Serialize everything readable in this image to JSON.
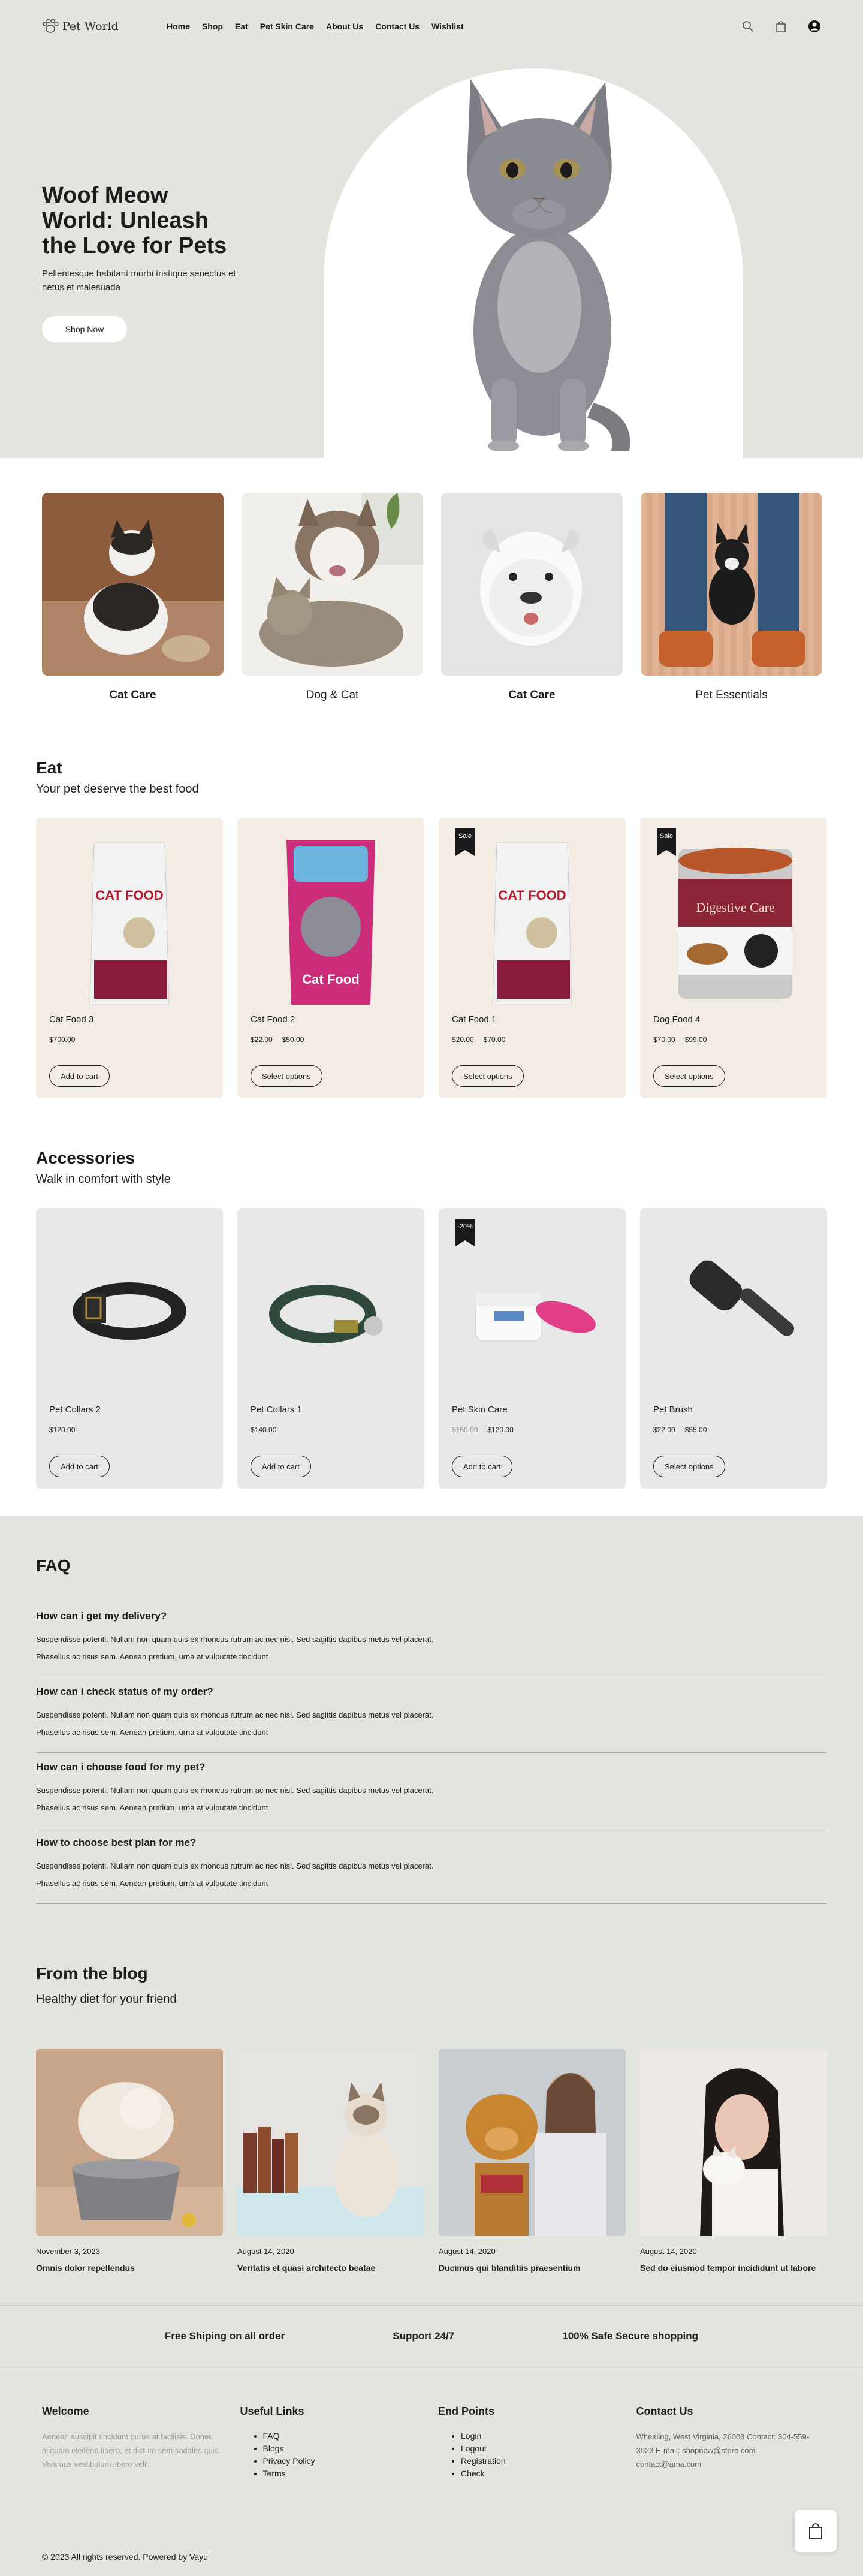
{
  "header": {
    "logo": "Pet World",
    "nav": [
      "Home",
      "Shop",
      "Eat",
      "Pet Skin Care",
      "About Us",
      "Contact Us",
      "Wishlist"
    ],
    "icons": [
      "search-icon",
      "bag-icon",
      "account-icon"
    ]
  },
  "hero": {
    "title": "Woof Meow World: Unleash the Love for Pets",
    "subtitle": "Pellentesque habitant morbi tristique senectus et netus et malesuada",
    "button": "Shop Now"
  },
  "categories": [
    {
      "label": "Cat Care",
      "bold": true
    },
    {
      "label": "Dog & Cat",
      "bold": false
    },
    {
      "label": "Cat Care",
      "bold": true
    },
    {
      "label": "Pet Essentials",
      "bold": false
    }
  ],
  "eat": {
    "title": "Eat",
    "subtitle": "Your pet deserve the best food",
    "products": [
      {
        "name": "Cat Food 3",
        "price": "$700.00",
        "price2": "",
        "old": "",
        "button": "Add to cart",
        "badge": ""
      },
      {
        "name": "Cat Food 2",
        "price": "$22.00",
        "price2": "$50.00",
        "old": "",
        "button": "Select options",
        "badge": ""
      },
      {
        "name": "Cat Food 1",
        "price": "$20.00",
        "price2": "$70.00",
        "old": "",
        "button": "Select options",
        "badge": "Sale"
      },
      {
        "name": "Dog Food 4",
        "price": "$70.00",
        "price2": "$99.00",
        "old": "",
        "button": "Select options",
        "badge": "Sale"
      }
    ]
  },
  "accessories": {
    "title": "Accessories",
    "subtitle": "Walk in comfort with style",
    "products": [
      {
        "name": "Pet Collars 2",
        "price": "$120.00",
        "price2": "",
        "old": "",
        "button": "Add to cart",
        "badge": ""
      },
      {
        "name": "Pet Collars 1",
        "price": "$140.00",
        "price2": "",
        "old": "",
        "button": "Add to cart",
        "badge": ""
      },
      {
        "name": "Pet Skin Care",
        "price": "$120.00",
        "price2": "",
        "old": "$150.00",
        "button": "Add to cart",
        "badge": "-20%"
      },
      {
        "name": "Pet Brush",
        "price": "$22.00",
        "price2": "$55.00",
        "old": "",
        "button": "Select options",
        "badge": ""
      }
    ]
  },
  "faq": {
    "title": "FAQ",
    "items": [
      {
        "q": "How can i get my delivery?",
        "a1": "Suspendisse potenti. Nullam non quam quis ex rhoncus rutrum ac nec nisi. Sed sagittis dapibus metus vel placerat.",
        "a2": "Phasellus ac risus sem. Aenean pretium, urna at vulputate tincidunt"
      },
      {
        "q": "How can i check status of my order?",
        "a1": "Suspendisse potenti. Nullam non quam quis ex rhoncus rutrum ac nec nisi. Sed sagittis dapibus metus vel placerat.",
        "a2": "Phasellus ac risus sem. Aenean pretium, urna at vulputate tincidunt"
      },
      {
        "q": "How can i choose food for my pet?",
        "a1": "Suspendisse potenti. Nullam non quam quis ex rhoncus rutrum ac nec nisi. Sed sagittis dapibus metus vel placerat.",
        "a2": "Phasellus ac risus sem. Aenean pretium, urna at vulputate tincidunt"
      },
      {
        "q": "How to choose best plan for me?",
        "a1": "Suspendisse potenti. Nullam non quam quis ex rhoncus rutrum ac nec nisi. Sed sagittis dapibus metus vel placerat.",
        "a2": "Phasellus ac risus sem. Aenean pretium, urna at vulputate tincidunt"
      }
    ]
  },
  "blog": {
    "title": "From the blog",
    "subtitle": "Healthy diet for your friend",
    "posts": [
      {
        "date": "November 3, 2023",
        "title": "Omnis dolor repellendus"
      },
      {
        "date": "August 14, 2020",
        "title": "Veritatis et quasi architecto beatae"
      },
      {
        "date": "August 14, 2020",
        "title": "Ducimus qui blanditiis praesentium"
      },
      {
        "date": "August 14, 2020",
        "title": "Sed do eiusmod tempor incididunt ut labore"
      }
    ]
  },
  "features": [
    "Free Shiping on all order",
    "Support 24/7",
    "100% Safe Secure shopping"
  ],
  "footer": {
    "welcome": {
      "title": "Welcome",
      "text": "Aenean suscipit tincidunt purus at facilisis. Donec aliquam eleifend libero, et dictum sem sodales quis. Vivamus vestibulum libero velit"
    },
    "links": {
      "title": "Useful Links",
      "items": [
        "FAQ",
        "Blogs",
        "Privacy Policy",
        "Terms"
      ]
    },
    "endpoints": {
      "title": "End Points",
      "items": [
        "Login",
        "Logout",
        "Registration",
        "Check"
      ]
    },
    "contact": {
      "title": "Contact Us",
      "text": "Wheeling, West Virginia, 26003 Contact: 304-559-3023 E-mail: shopnow@store.com contact@ama.com"
    },
    "copyright": "© 2023 All rights reserved. Powered by Vayu"
  },
  "colors": {
    "bg_grey": "#e2e4de",
    "food_card": "#f3ece5",
    "acc_card": "#e8e8e8",
    "text": "#1d1d1d"
  }
}
